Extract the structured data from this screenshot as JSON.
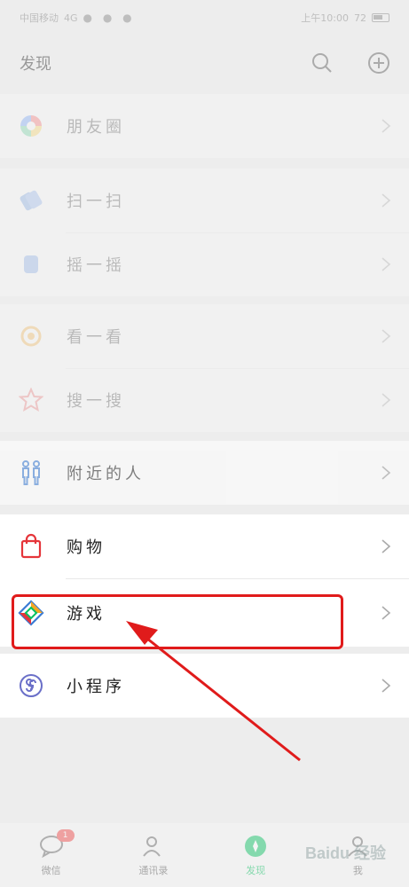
{
  "status_bar": {
    "carrier": "中国移动",
    "signal": "4G",
    "time": "上午10:00",
    "battery": "72"
  },
  "header": {
    "title": "发现"
  },
  "groups": [
    {
      "items": [
        {
          "label": "朋友圈",
          "icon": "moments-icon"
        }
      ]
    },
    {
      "items": [
        {
          "label": "扫一扫",
          "icon": "scan-icon"
        },
        {
          "label": "摇一摇",
          "icon": "shake-icon"
        }
      ]
    },
    {
      "items": [
        {
          "label": "看一看",
          "icon": "top-stories-icon"
        },
        {
          "label": "搜一搜",
          "icon": "search-star-icon"
        }
      ]
    },
    {
      "items": [
        {
          "label": "附近的人",
          "icon": "people-nearby-icon"
        }
      ]
    },
    {
      "items": [
        {
          "label": "购物",
          "icon": "shopping-bag-icon"
        },
        {
          "label": "游戏",
          "icon": "games-icon"
        }
      ]
    },
    {
      "items": [
        {
          "label": "小程序",
          "icon": "mini-programs-icon"
        }
      ]
    }
  ],
  "tabbar": {
    "tabs": [
      {
        "label": "微信",
        "badge": "1"
      },
      {
        "label": "通讯录"
      },
      {
        "label": "发现"
      },
      {
        "label": "我"
      }
    ]
  },
  "watermark": "Baidu 经验",
  "colors": {
    "highlight": "#e01b1b",
    "accent": "#07c160",
    "background": "#ededed"
  }
}
